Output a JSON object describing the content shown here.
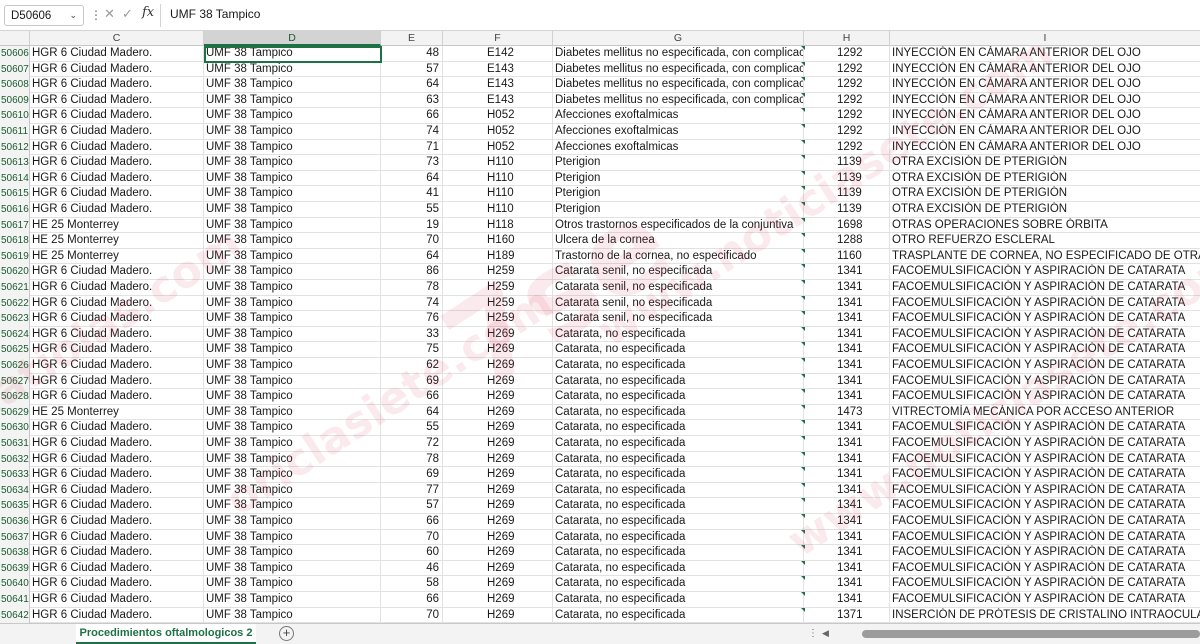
{
  "formula_bar": {
    "name_box": "D50606",
    "formula": "UMF 38 Tampico",
    "cancel_icon": "✕",
    "enter_icon": "✓",
    "fx_label": "fx"
  },
  "columns": [
    "C",
    "D",
    "E",
    "F",
    "G",
    "H",
    "I"
  ],
  "active_cell": "D50606",
  "rows": [
    {
      "n": "50606",
      "c": "HGR 6 Ciudad Madero.",
      "d": "UMF 38 Tampico",
      "e": "48",
      "f": "E142",
      "g": "Diabetes mellitus no especificada, con complicacio",
      "h": "1292",
      "i": "INYECCIÓN EN CÁMARA ANTERIOR DEL OJO"
    },
    {
      "n": "50607",
      "c": "HGR 6 Ciudad Madero.",
      "d": "UMF 38 Tampico",
      "e": "57",
      "f": "E143",
      "g": "Diabetes mellitus no especificada, con complicacio",
      "h": "1292",
      "i": "INYECCIÓN EN CÁMARA ANTERIOR DEL OJO"
    },
    {
      "n": "50608",
      "c": "HGR 6 Ciudad Madero.",
      "d": "UMF 38 Tampico",
      "e": "64",
      "f": "E143",
      "g": "Diabetes mellitus no especificada, con complicacio",
      "h": "1292",
      "i": "INYECCIÓN EN CÁMARA ANTERIOR DEL OJO"
    },
    {
      "n": "50609",
      "c": "HGR 6 Ciudad Madero.",
      "d": "UMF 38 Tampico",
      "e": "63",
      "f": "E143",
      "g": "Diabetes mellitus no especificada, con complicacio",
      "h": "1292",
      "i": "INYECCIÓN EN CÁMARA ANTERIOR DEL OJO"
    },
    {
      "n": "50610",
      "c": "HGR 6 Ciudad Madero.",
      "d": "UMF 38 Tampico",
      "e": "66",
      "f": "H052",
      "g": "Afecciones exoftalmicas",
      "h": "1292",
      "i": "INYECCIÓN EN CÁMARA ANTERIOR DEL OJO"
    },
    {
      "n": "50611",
      "c": "HGR 6 Ciudad Madero.",
      "d": "UMF 38 Tampico",
      "e": "74",
      "f": "H052",
      "g": "Afecciones exoftalmicas",
      "h": "1292",
      "i": "INYECCIÓN EN CÁMARA ANTERIOR DEL OJO"
    },
    {
      "n": "50612",
      "c": "HGR 6 Ciudad Madero.",
      "d": "UMF 38 Tampico",
      "e": "71",
      "f": "H052",
      "g": "Afecciones exoftalmicas",
      "h": "1292",
      "i": "INYECCIÓN EN CÁMARA ANTERIOR DEL OJO"
    },
    {
      "n": "50613",
      "c": "HGR 6 Ciudad Madero.",
      "d": "UMF 38 Tampico",
      "e": "73",
      "f": "H110",
      "g": "Pterigion",
      "h": "1139",
      "i": "OTRA EXCISIÓN DE PTERIGIÓN"
    },
    {
      "n": "50614",
      "c": "HGR 6 Ciudad Madero.",
      "d": "UMF 38 Tampico",
      "e": "64",
      "f": "H110",
      "g": "Pterigion",
      "h": "1139",
      "i": "OTRA EXCISIÓN DE PTERIGIÓN"
    },
    {
      "n": "50615",
      "c": "HGR 6 Ciudad Madero.",
      "d": "UMF 38 Tampico",
      "e": "41",
      "f": "H110",
      "g": "Pterigion",
      "h": "1139",
      "i": "OTRA EXCISIÓN DE PTERIGIÓN"
    },
    {
      "n": "50616",
      "c": "HGR 6 Ciudad Madero.",
      "d": "UMF 38 Tampico",
      "e": "55",
      "f": "H110",
      "g": "Pterigion",
      "h": "1139",
      "i": "OTRA EXCISIÓN DE PTERIGIÓN"
    },
    {
      "n": "50617",
      "c": "HE 25 Monterrey",
      "d": "UMF 38 Tampico",
      "e": "19",
      "f": "H118",
      "g": "Otros trastornos especificados de la conjuntiva",
      "h": "1698",
      "i": "OTRAS OPERACIONES SOBRE ÓRBITA"
    },
    {
      "n": "50618",
      "c": "HE 25 Monterrey",
      "d": "UMF 38 Tampico",
      "e": "70",
      "f": "H160",
      "g": "Ulcera de la cornea",
      "h": "1288",
      "i": "OTRO REFUERZO ESCLERAL"
    },
    {
      "n": "50619",
      "c": "HE 25 Monterrey",
      "d": "UMF 38 Tampico",
      "e": "64",
      "f": "H189",
      "g": "Trastorno de la cornea, no especificado",
      "h": "1160",
      "i": "TRASPLANTE DE CORNEA, NO ESPECIFICADO DE OTRA MANERA"
    },
    {
      "n": "50620",
      "c": "HGR 6 Ciudad Madero.",
      "d": "UMF 38 Tampico",
      "e": "86",
      "f": "H259",
      "g": "Catarata senil, no especificada",
      "h": "1341",
      "i": "FACOEMULSIFICACIÓN Y ASPIRACIÓN DE CATARATA"
    },
    {
      "n": "50621",
      "c": "HGR 6 Ciudad Madero.",
      "d": "UMF 38 Tampico",
      "e": "78",
      "f": "H259",
      "g": "Catarata senil, no especificada",
      "h": "1341",
      "i": "FACOEMULSIFICACIÓN Y ASPIRACIÓN DE CATARATA"
    },
    {
      "n": "50622",
      "c": "HGR 6 Ciudad Madero.",
      "d": "UMF 38 Tampico",
      "e": "74",
      "f": "H259",
      "g": "Catarata senil, no especificada",
      "h": "1341",
      "i": "FACOEMULSIFICACIÓN Y ASPIRACIÓN DE CATARATA"
    },
    {
      "n": "50623",
      "c": "HGR 6 Ciudad Madero.",
      "d": "UMF 38 Tampico",
      "e": "76",
      "f": "H259",
      "g": "Catarata senil, no especificada",
      "h": "1341",
      "i": "FACOEMULSIFICACIÓN Y ASPIRACIÓN DE CATARATA"
    },
    {
      "n": "50624",
      "c": "HGR 6 Ciudad Madero.",
      "d": "UMF 38 Tampico",
      "e": "33",
      "f": "H269",
      "g": "Catarata, no especificada",
      "h": "1341",
      "i": "FACOEMULSIFICACIÓN Y ASPIRACIÓN DE CATARATA"
    },
    {
      "n": "50625",
      "c": "HGR 6 Ciudad Madero.",
      "d": "UMF 38 Tampico",
      "e": "75",
      "f": "H269",
      "g": "Catarata, no especificada",
      "h": "1341",
      "i": "FACOEMULSIFICACIÓN Y ASPIRACIÓN DE CATARATA"
    },
    {
      "n": "50626",
      "c": "HGR 6 Ciudad Madero.",
      "d": "UMF 38 Tampico",
      "e": "62",
      "f": "H269",
      "g": "Catarata, no especificada",
      "h": "1341",
      "i": "FACOEMULSIFICACIÓN Y ASPIRACIÓN DE CATARATA"
    },
    {
      "n": "50627",
      "c": "HGR 6 Ciudad Madero.",
      "d": "UMF 38 Tampico",
      "e": "69",
      "f": "H269",
      "g": "Catarata, no especificada",
      "h": "1341",
      "i": "FACOEMULSIFICACIÓN Y ASPIRACIÓN DE CATARATA"
    },
    {
      "n": "50628",
      "c": "HGR 6 Ciudad Madero.",
      "d": "UMF 38 Tampico",
      "e": "66",
      "f": "H269",
      "g": "Catarata, no especificada",
      "h": "1341",
      "i": "FACOEMULSIFICACIÓN Y ASPIRACIÓN DE CATARATA"
    },
    {
      "n": "50629",
      "c": "HE 25 Monterrey",
      "d": "UMF 38 Tampico",
      "e": "64",
      "f": "H269",
      "g": "Catarata, no especificada",
      "h": "1473",
      "i": "VITRECTOMÍA MECÁNICA POR ACCESO ANTERIOR"
    },
    {
      "n": "50630",
      "c": "HGR 6 Ciudad Madero.",
      "d": "UMF 38 Tampico",
      "e": "55",
      "f": "H269",
      "g": "Catarata, no especificada",
      "h": "1341",
      "i": "FACOEMULSIFICACIÓN Y ASPIRACIÓN DE CATARATA"
    },
    {
      "n": "50631",
      "c": "HGR 6 Ciudad Madero.",
      "d": "UMF 38 Tampico",
      "e": "72",
      "f": "H269",
      "g": "Catarata, no especificada",
      "h": "1341",
      "i": "FACOEMULSIFICACIÓN Y ASPIRACIÓN DE CATARATA"
    },
    {
      "n": "50632",
      "c": "HGR 6 Ciudad Madero.",
      "d": "UMF 38 Tampico",
      "e": "78",
      "f": "H269",
      "g": "Catarata, no especificada",
      "h": "1341",
      "i": "FACOEMULSIFICACIÓN Y ASPIRACIÓN DE CATARATA"
    },
    {
      "n": "50633",
      "c": "HGR 6 Ciudad Madero.",
      "d": "UMF 38 Tampico",
      "e": "69",
      "f": "H269",
      "g": "Catarata, no especificada",
      "h": "1341",
      "i": "FACOEMULSIFICACIÓN Y ASPIRACIÓN DE CATARATA"
    },
    {
      "n": "50634",
      "c": "HGR 6 Ciudad Madero.",
      "d": "UMF 38 Tampico",
      "e": "77",
      "f": "H269",
      "g": "Catarata, no especificada",
      "h": "1341",
      "i": "FACOEMULSIFICACIÓN Y ASPIRACIÓN DE CATARATA"
    },
    {
      "n": "50635",
      "c": "HGR 6 Ciudad Madero.",
      "d": "UMF 38 Tampico",
      "e": "57",
      "f": "H269",
      "g": "Catarata, no especificada",
      "h": "1341",
      "i": "FACOEMULSIFICACIÓN Y ASPIRACIÓN DE CATARATA"
    },
    {
      "n": "50636",
      "c": "HGR 6 Ciudad Madero.",
      "d": "UMF 38 Tampico",
      "e": "66",
      "f": "H269",
      "g": "Catarata, no especificada",
      "h": "1341",
      "i": "FACOEMULSIFICACIÓN Y ASPIRACIÓN DE CATARATA"
    },
    {
      "n": "50637",
      "c": "HGR 6 Ciudad Madero.",
      "d": "UMF 38 Tampico",
      "e": "70",
      "f": "H269",
      "g": "Catarata, no especificada",
      "h": "1341",
      "i": "FACOEMULSIFICACIÓN Y ASPIRACIÓN DE CATARATA"
    },
    {
      "n": "50638",
      "c": "HGR 6 Ciudad Madero.",
      "d": "UMF 38 Tampico",
      "e": "60",
      "f": "H269",
      "g": "Catarata, no especificada",
      "h": "1341",
      "i": "FACOEMULSIFICACIÓN Y ASPIRACIÓN DE CATARATA"
    },
    {
      "n": "50639",
      "c": "HGR 6 Ciudad Madero.",
      "d": "UMF 38 Tampico",
      "e": "46",
      "f": "H269",
      "g": "Catarata, no especificada",
      "h": "1341",
      "i": "FACOEMULSIFICACIÓN Y ASPIRACIÓN DE CATARATA"
    },
    {
      "n": "50640",
      "c": "HGR 6 Ciudad Madero.",
      "d": "UMF 38 Tampico",
      "e": "58",
      "f": "H269",
      "g": "Catarata, no especificada",
      "h": "1341",
      "i": "FACOEMULSIFICACIÓN Y ASPIRACIÓN DE CATARATA"
    },
    {
      "n": "50641",
      "c": "HGR 6 Ciudad Madero.",
      "d": "UMF 38 Tampico",
      "e": "66",
      "f": "H269",
      "g": "Catarata, no especificada",
      "h": "1341",
      "i": "FACOEMULSIFICACIÓN Y ASPIRACIÓN DE CATARATA"
    },
    {
      "n": "50642",
      "c": "HGR 6 Ciudad Madero.",
      "d": "UMF 38 Tampico",
      "e": "70",
      "f": "H269",
      "g": "Catarata, no especificada",
      "h": "1371",
      "i": "INSERCIÓN DE PRÓTESIS DE CRISTALINO INTRAOCULAR EN EL MOM"
    }
  ],
  "sheet_tabs": [
    "Procedimientos oftalmologicos 2"
  ],
  "add_sheet_icon": "+",
  "colors": {
    "accent": "#1e7145",
    "header_bg": "#f3f3f3",
    "watermark": "#dc3c5a"
  }
}
